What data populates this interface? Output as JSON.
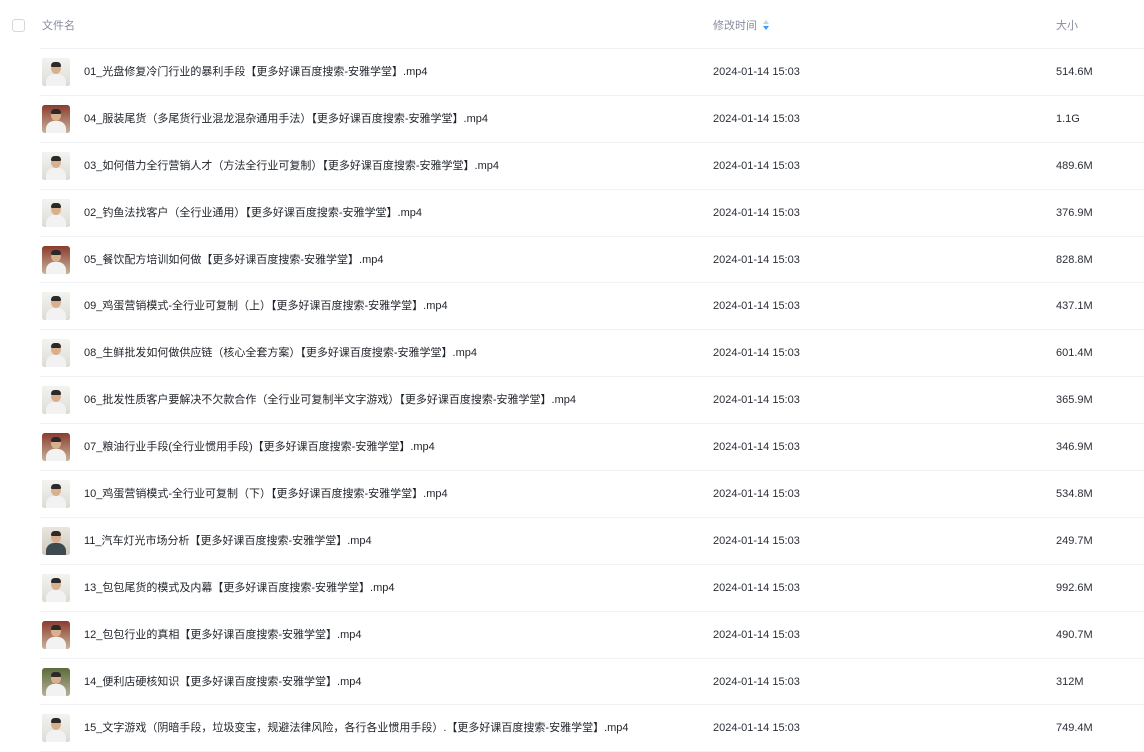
{
  "header": {
    "name_label": "文件名",
    "time_label": "修改时间",
    "size_label": "大小"
  },
  "files": [
    {
      "name": "01_光盘修复冷门行业的暴利手段【更多好课百度搜索-安雅学堂】.mp4",
      "modified": "2024-01-14 15:03",
      "size": "514.6M",
      "thumb": "light"
    },
    {
      "name": "04_服装尾货（多尾货行业混龙混杂通用手法）【更多好课百度搜索-安雅学堂】.mp4",
      "modified": "2024-01-14 15:03",
      "size": "1.1G",
      "thumb": "red"
    },
    {
      "name": "03_如何借力全行营销人才（方法全行业可复制）【更多好课百度搜索-安雅学堂】.mp4",
      "modified": "2024-01-14 15:03",
      "size": "489.6M",
      "thumb": "light"
    },
    {
      "name": "02_钓鱼法找客户（全行业通用）【更多好课百度搜索-安雅学堂】.mp4",
      "modified": "2024-01-14 15:03",
      "size": "376.9M",
      "thumb": "light"
    },
    {
      "name": "05_餐饮配方培训如何做【更多好课百度搜索-安雅学堂】.mp4",
      "modified": "2024-01-14 15:03",
      "size": "828.8M",
      "thumb": "red"
    },
    {
      "name": "09_鸡蛋营销模式-全行业可复制（上）【更多好课百度搜索-安雅学堂】.mp4",
      "modified": "2024-01-14 15:03",
      "size": "437.1M",
      "thumb": "light"
    },
    {
      "name": "08_生鲜批发如何做供应链（核心全套方案）【更多好课百度搜索-安雅学堂】.mp4",
      "modified": "2024-01-14 15:03",
      "size": "601.4M",
      "thumb": "light"
    },
    {
      "name": "06_批发性质客户要解决不欠款合作（全行业可复制半文字游戏）【更多好课百度搜索-安雅学堂】.mp4",
      "modified": "2024-01-14 15:03",
      "size": "365.9M",
      "thumb": "light"
    },
    {
      "name": "07_粮油行业手段(全行业惯用手段)【更多好课百度搜索-安雅学堂】.mp4",
      "modified": "2024-01-14 15:03",
      "size": "346.9M",
      "thumb": "red"
    },
    {
      "name": "10_鸡蛋营销模式-全行业可复制（下）【更多好课百度搜索-安雅学堂】.mp4",
      "modified": "2024-01-14 15:03",
      "size": "534.8M",
      "thumb": "light"
    },
    {
      "name": "11_汽车灯光市场分析【更多好课百度搜索-安雅学堂】.mp4",
      "modified": "2024-01-14 15:03",
      "size": "249.7M",
      "thumb": "dark"
    },
    {
      "name": "13_包包尾货的模式及内幕【更多好课百度搜索-安雅学堂】.mp4",
      "modified": "2024-01-14 15:03",
      "size": "992.6M",
      "thumb": "light"
    },
    {
      "name": "12_包包行业的真相【更多好课百度搜索-安雅学堂】.mp4",
      "modified": "2024-01-14 15:03",
      "size": "490.7M",
      "thumb": "red"
    },
    {
      "name": "14_便利店硬核知识【更多好课百度搜索-安雅学堂】.mp4",
      "modified": "2024-01-14 15:03",
      "size": "312M",
      "thumb": "green"
    },
    {
      "name": "15_文字游戏（阴暗手段，垃圾变宝，规避法律风险，各行各业惯用手段）.【更多好课百度搜索-安雅学堂】.mp4",
      "modified": "2024-01-14 15:03",
      "size": "749.4M",
      "thumb": "light"
    }
  ],
  "colors": {
    "header_text": "#878c9c",
    "row_text": "#1f2329",
    "divider": "#f1f2f5",
    "sort_icon": "#3b9cf5"
  },
  "icons": {
    "select_all": "checkbox-icon",
    "sort": "sort-icon",
    "thumbnail": "video-thumbnail-icon"
  }
}
